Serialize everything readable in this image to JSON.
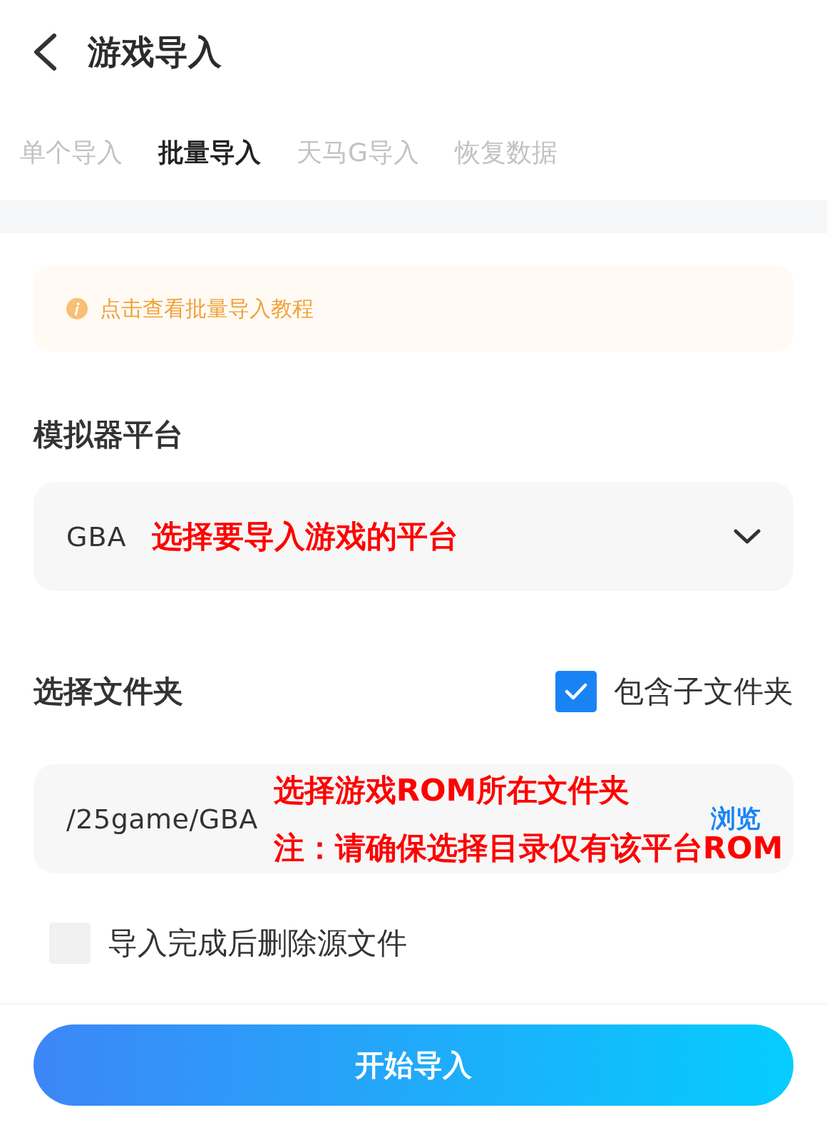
{
  "header": {
    "title": "游戏导入"
  },
  "tabs": [
    {
      "label": "单个导入",
      "selected": false
    },
    {
      "label": "批量导入",
      "selected": true
    },
    {
      "label": "天马G导入",
      "selected": false
    },
    {
      "label": "恢复数据",
      "selected": false
    }
  ],
  "tip": {
    "text": "点击查看批量导入教程"
  },
  "platform": {
    "label": "模拟器平台",
    "value": "GBA",
    "annotation": "选择要导入游戏的平台"
  },
  "folder": {
    "label": "选择文件夹",
    "include_subfolders": {
      "label": "包含子文件夹",
      "checked": true
    },
    "path": "/25game/GBA",
    "annotations": [
      "选择游戏ROM所在文件夹",
      "注：请确保选择目录仅有该平台ROM"
    ],
    "browse": "浏览"
  },
  "delete_source": {
    "label": "导入完成后删除源文件",
    "checked": false
  },
  "start_button": "开始导入"
}
